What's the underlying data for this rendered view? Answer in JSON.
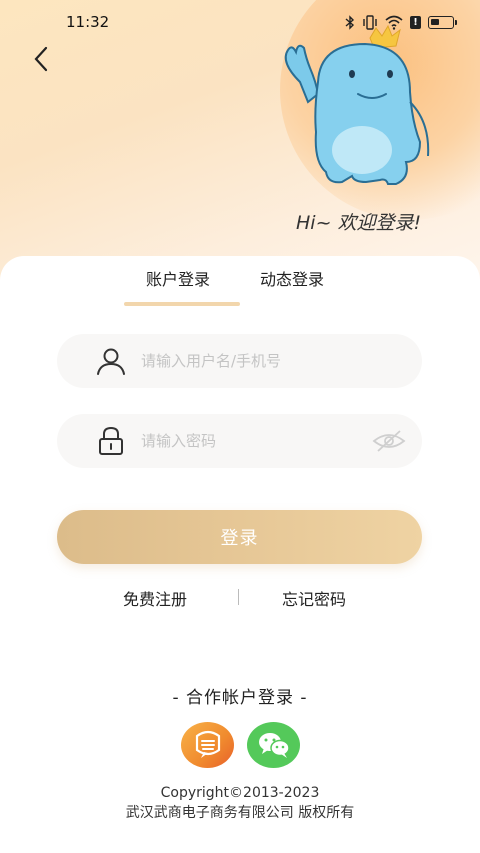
{
  "status_bar": {
    "time": "11:32",
    "icons": [
      "bluetooth-icon",
      "vibrate-icon",
      "wifi-icon",
      "alert-icon",
      "battery-icon"
    ],
    "alert_badge": "!"
  },
  "header": {
    "back_icon": "chevron-left-icon",
    "greeting": "Hi~ 欢迎登录!"
  },
  "tabs": [
    {
      "label": "账户登录",
      "active": true
    },
    {
      "label": "动态登录",
      "active": false
    }
  ],
  "form": {
    "username": {
      "placeholder": "请输入用户名/手机号",
      "value": "",
      "icon": "user-icon"
    },
    "password": {
      "placeholder": "请输入密码",
      "value": "",
      "icon": "lock-icon",
      "toggle_icon": "eye-hidden-icon"
    },
    "login_label": "登录"
  },
  "links": {
    "register": "免费注册",
    "forgot": "忘记密码"
  },
  "partner": {
    "title": "- 合作帐户登录 -",
    "icons": [
      "wuhan-business-icon",
      "wechat-icon"
    ]
  },
  "footer": {
    "copyright": "Copyright©2013-2023",
    "company": "武汉武商电子商务有限公司 版权所有"
  },
  "colors": {
    "accent": "#e6c796",
    "tab_underline": "#f2d6ac",
    "wechat": "#54c95a"
  }
}
